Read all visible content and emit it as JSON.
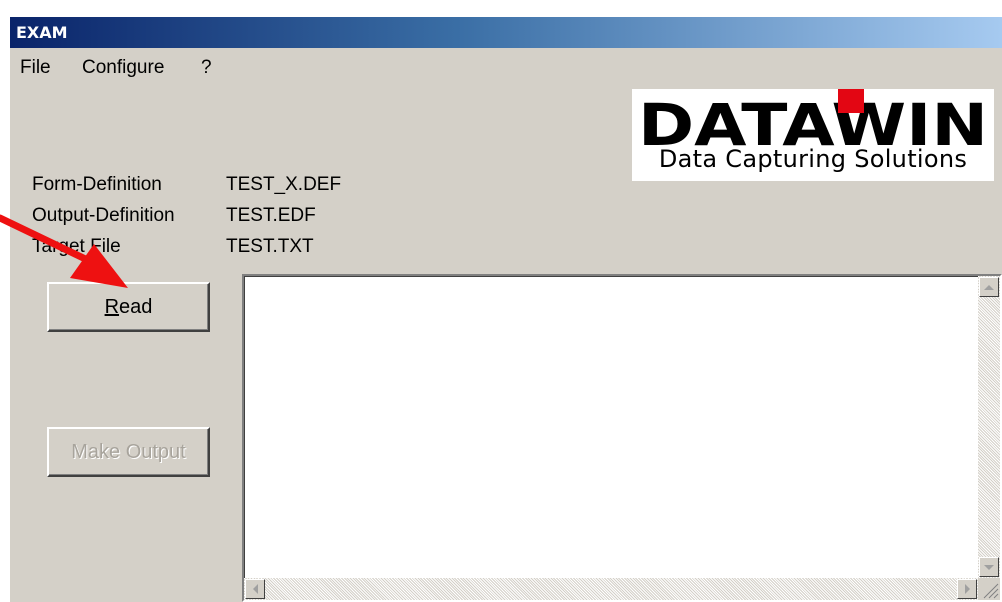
{
  "window": {
    "title": "EXAM"
  },
  "menu": {
    "items": [
      "File",
      "Configure",
      "?"
    ]
  },
  "logo": {
    "brand": "DATAWIN",
    "tagline": "Data Capturing Solutions",
    "accent_color": "#e30613"
  },
  "info": {
    "rows": [
      {
        "label": "Form-Definition",
        "value": "TEST_X.DEF"
      },
      {
        "label": "Output-Definition",
        "value": "TEST.EDF"
      },
      {
        "label": "Target File",
        "value": "TEST.TXT"
      }
    ]
  },
  "buttons": {
    "read": {
      "label": "Read",
      "mnemonic": "R",
      "rest": "ead",
      "enabled": true
    },
    "make_output": {
      "label": "Make Output",
      "enabled": false
    }
  },
  "output_area": {
    "content": ""
  },
  "annotation": {
    "arrow_color": "#ee1111",
    "points_to": "read-button"
  }
}
